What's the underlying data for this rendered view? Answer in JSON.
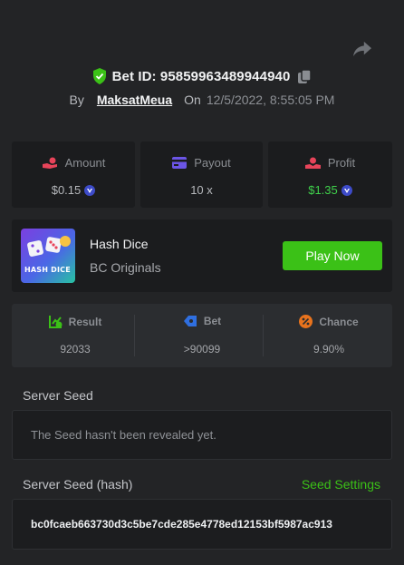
{
  "header": {
    "bet_id": "Bet ID: 95859963489944940",
    "by_label": "By",
    "username": "MaksatMeua",
    "on_label": "On",
    "datetime": "12/5/2022, 8:55:05 PM"
  },
  "stats": {
    "amount": {
      "label": "Amount",
      "value": "$0.15",
      "icon": "hand-coin-icon",
      "color": "#e8445a"
    },
    "payout": {
      "label": "Payout",
      "value": "10 x",
      "icon": "card-icon",
      "color": "#6b55e6"
    },
    "profit": {
      "label": "Profit",
      "value": "$1.35",
      "icon": "hand-money-icon",
      "color": "#e8445a",
      "value_color": "#3fd14b"
    }
  },
  "game": {
    "name": "Hash Dice",
    "provider": "BC Originals",
    "thumb_text": "HASH DICE",
    "play_label": "Play Now"
  },
  "result": {
    "result": {
      "label": "Result",
      "value": "92033",
      "icon": "chart-check-icon",
      "color": "#3bc117"
    },
    "bet": {
      "label": "Bet",
      "value": ">90099",
      "icon": "tag-icon",
      "color": "#2f6fe0"
    },
    "chance": {
      "label": "Chance",
      "value": "9.90%",
      "icon": "percent-icon",
      "color": "#e8731d"
    }
  },
  "server_seed": {
    "label": "Server Seed",
    "message": "The Seed hasn't been revealed yet."
  },
  "server_seed_hash": {
    "label": "Server Seed (hash)",
    "settings_label": "Seed Settings",
    "hash": "bc0fcaeb663730d3c5be7cde285e4778ed12153bf5987ac913"
  }
}
